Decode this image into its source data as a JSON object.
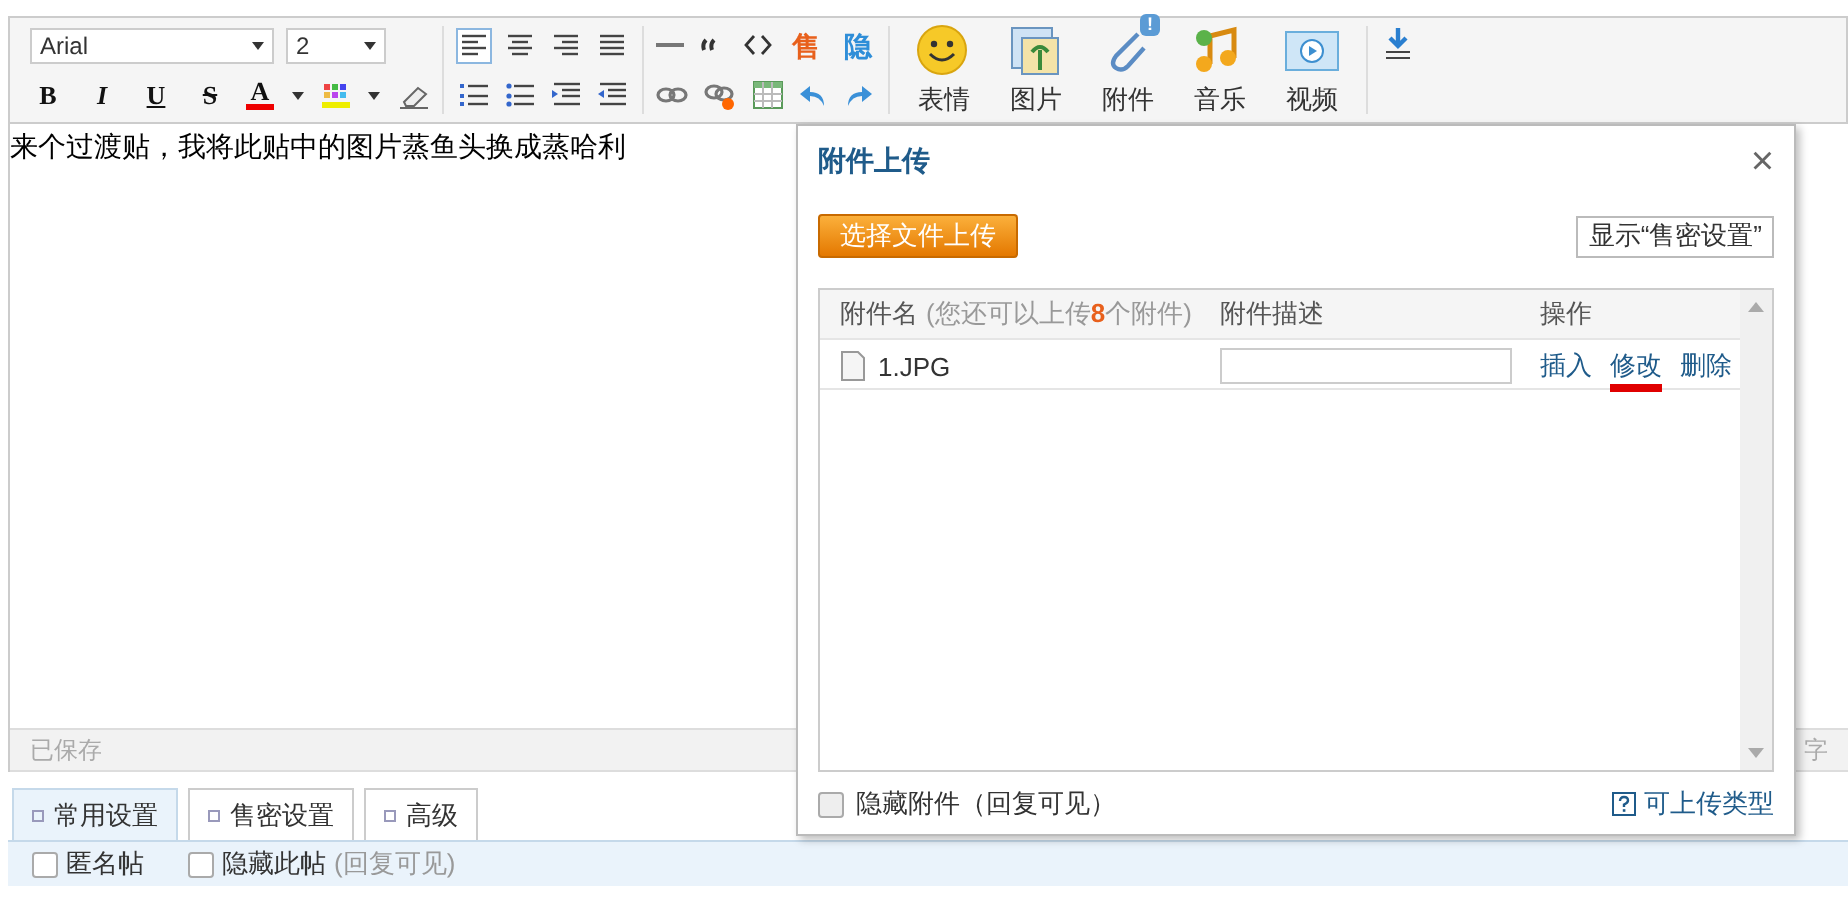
{
  "toolbar": {
    "font": "Arial",
    "size": "2",
    "format_buttons": [
      {
        "glyph": "B",
        "kind": "bold"
      },
      {
        "glyph": "I",
        "kind": "italic"
      },
      {
        "glyph": "U",
        "kind": "underline"
      },
      {
        "glyph": "S",
        "kind": "strike"
      },
      {
        "glyph": "A",
        "kind": "color"
      }
    ],
    "alignments": [
      {
        "kind": "left",
        "selected": true
      },
      {
        "kind": "center",
        "selected": false
      },
      {
        "kind": "right",
        "selected": false
      },
      {
        "kind": "justify",
        "selected": false
      }
    ],
    "glyph_buttons": [
      {
        "glyph": "售",
        "color": "#e8601c"
      },
      {
        "glyph": "隐",
        "color": "#2f8ed8"
      }
    ],
    "media": [
      {
        "label": "表情",
        "kind": "emoji"
      },
      {
        "label": "图片",
        "kind": "image"
      },
      {
        "label": "附件",
        "kind": "attach",
        "badge": "!"
      },
      {
        "label": "音乐",
        "kind": "music"
      },
      {
        "label": "视频",
        "kind": "video"
      }
    ]
  },
  "editor": {
    "content": "来个过渡贴，我将此贴中的图片蒸鱼头换成蒸哈利",
    "status": "已保存",
    "counter": "字"
  },
  "dialog": {
    "title": "附件上传",
    "close": "×",
    "upload_button": "选择文件上传",
    "toggle_button": "显示“售密设置”",
    "columns": [
      {
        "label": "附件名",
        "hint_before": "(您还可以上传",
        "hint_count": "8",
        "hint_after": "个附件)"
      },
      {
        "label": "附件描述"
      },
      {
        "label": "操作"
      }
    ],
    "rows": [
      {
        "name": "1.JPG",
        "actions": [
          {
            "label": "插入",
            "highlighted": false
          },
          {
            "label": "修改",
            "highlighted": true
          },
          {
            "label": "删除",
            "highlighted": false
          }
        ]
      }
    ],
    "hide_attachment": {
      "label": "隐藏附件（回复可见）",
      "checked": false
    },
    "types_link": "可上传类型"
  },
  "tabs": [
    {
      "label": "常用设置",
      "selected": true
    },
    {
      "label": "售密设置",
      "selected": false
    },
    {
      "label": "高级",
      "selected": false
    }
  ],
  "options": [
    {
      "label": "匿名帖",
      "checked": false
    },
    {
      "label": "隐藏此帖",
      "hint": "(回复可见)",
      "checked": false
    }
  ]
}
